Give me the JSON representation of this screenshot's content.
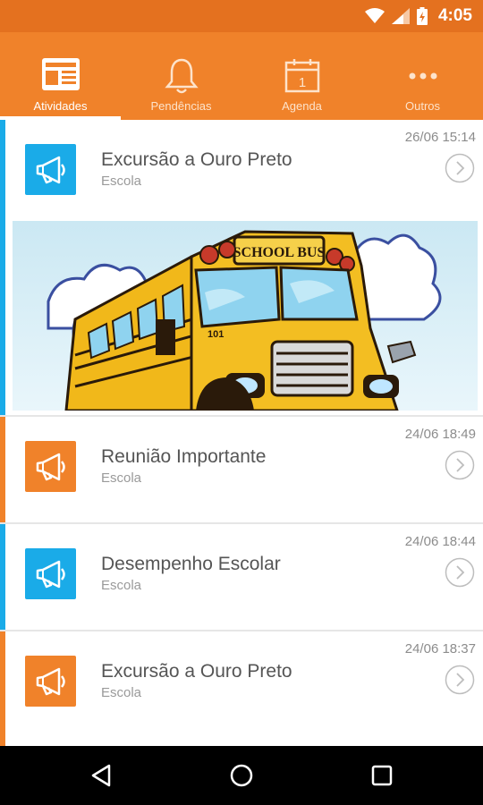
{
  "status_bar": {
    "time": "4:05"
  },
  "tabs": [
    {
      "label": "Atividades",
      "icon": "newspaper-icon",
      "active": true
    },
    {
      "label": "Pendências",
      "icon": "bell-icon",
      "active": false
    },
    {
      "label": "Agenda",
      "icon": "calendar-icon",
      "calendar_day": "1",
      "active": false
    },
    {
      "label": "Outros",
      "icon": "more-icon",
      "active": false
    }
  ],
  "feed": {
    "items": [
      {
        "time": "26/06 15:14",
        "title": "Excursão a Ouro Preto",
        "subtitle": "Escola",
        "accent": "#1aabe8",
        "icon": "megaphone-icon"
      },
      {
        "time": "24/06 18:49",
        "title": "Reunião Importante",
        "subtitle": "Escola",
        "accent": "#f0822a",
        "icon": "megaphone-icon"
      },
      {
        "time": "24/06 18:44",
        "title": "Desempenho Escolar",
        "subtitle": "Escola",
        "accent": "#1aabe8",
        "icon": "megaphone-icon"
      },
      {
        "time": "24/06 18:37",
        "title": "Excursão a Ouro Preto",
        "subtitle": "Escola",
        "accent": "#f0822a",
        "icon": "megaphone-icon"
      }
    ],
    "illustration": {
      "sign_text": "SCHOOL BUS",
      "bus_number": "101"
    }
  },
  "colors": {
    "brand_orange": "#f0822a",
    "status_orange": "#e4711f",
    "accent_blue": "#1aabe8"
  }
}
